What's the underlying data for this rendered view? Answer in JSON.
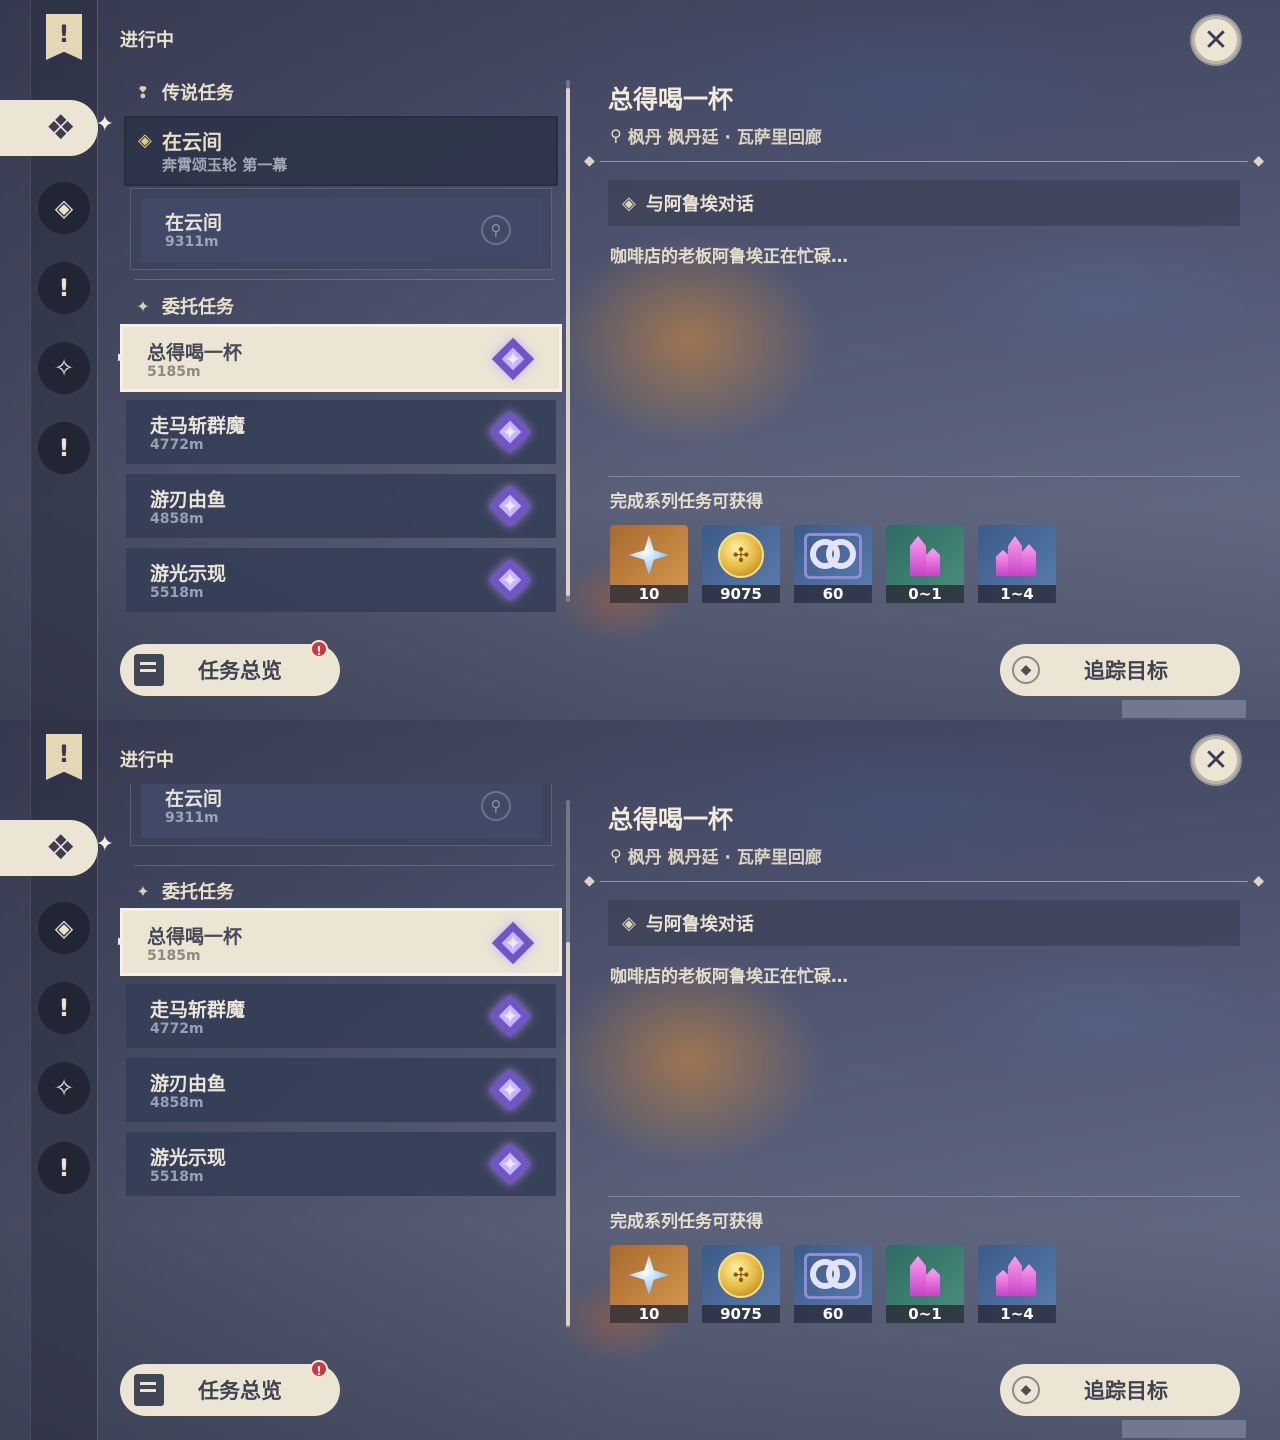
{
  "status_title": "进行中",
  "close_label": "✕",
  "legend_section": {
    "title": "传说任务",
    "quest_title": "在云间",
    "quest_subtitle": "奔霄颂玉轮 第一幕",
    "step_title": "在云间",
    "step_distance": "9311m"
  },
  "commission_section": {
    "title": "委托任务"
  },
  "quests": [
    {
      "title": "总得喝一杯",
      "distance": "5185m",
      "selected": true
    },
    {
      "title": "走马斩群魔",
      "distance": "4772m",
      "selected": false
    },
    {
      "title": "游刃由鱼",
      "distance": "4858m",
      "selected": false
    },
    {
      "title": "游光示现",
      "distance": "5518m",
      "selected": false
    }
  ],
  "detail": {
    "title": "总得喝一杯",
    "location": "枫丹 枫丹廷 · 瓦萨里回廊",
    "objective": "与阿鲁埃对话",
    "description": "咖啡店的老板阿鲁埃正在忙碌…",
    "reward_title": "完成系列任务可获得",
    "rewards": [
      {
        "icon": "primogem-icon",
        "count": "10"
      },
      {
        "icon": "mora-coin-icon",
        "count": "9075"
      },
      {
        "icon": "friendship-exp-icon",
        "count": "60"
      },
      {
        "icon": "crystal-shard-icon",
        "count": "0~1"
      },
      {
        "icon": "crystal-cluster-icon",
        "count": "1~4"
      }
    ]
  },
  "buttons": {
    "overview": "任务总览",
    "overview_badge": "!",
    "track": "追踪目标"
  }
}
